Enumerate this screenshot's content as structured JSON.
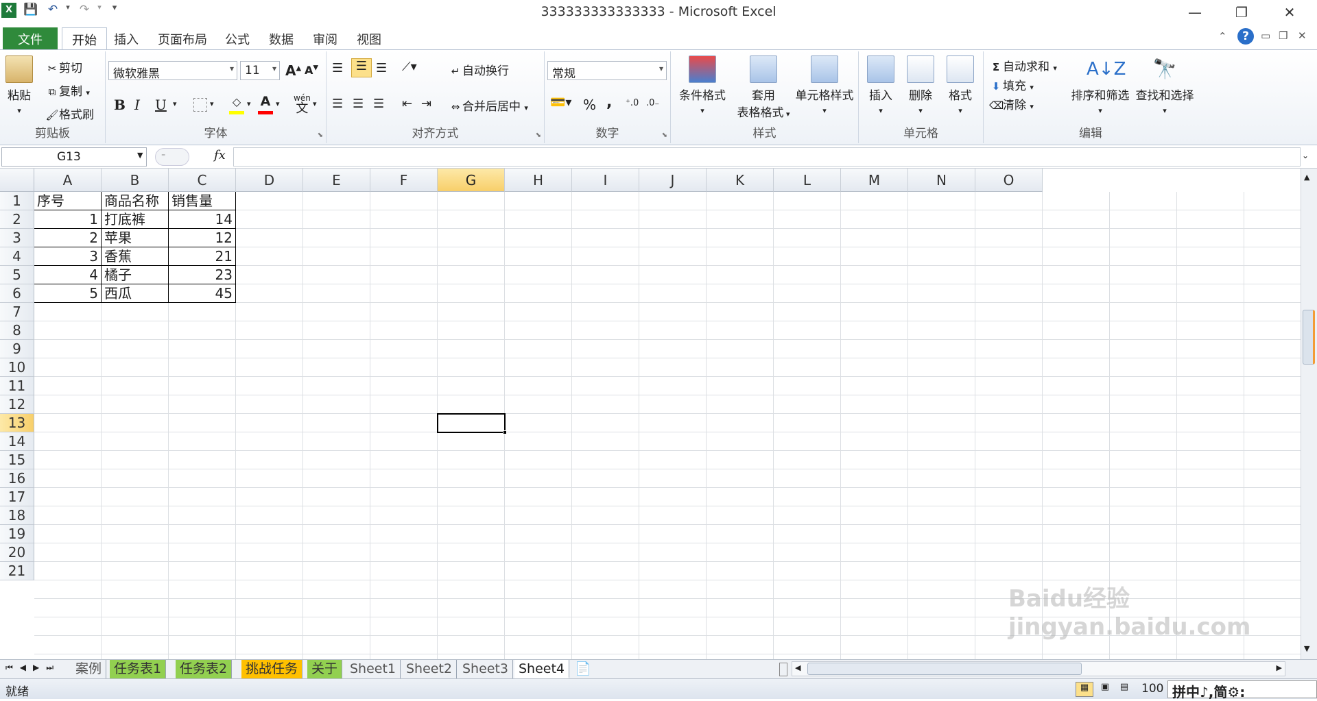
{
  "titlebar": {
    "title": "333333333333333 - Microsoft Excel",
    "qa_icons": [
      "excel-logo-icon",
      "save-icon",
      "undo-icon",
      "redo-icon",
      "customize-icon"
    ]
  },
  "tabs": [
    "文件",
    "开始",
    "插入",
    "页面布局",
    "公式",
    "数据",
    "审阅",
    "视图"
  ],
  "ribbon": {
    "clipboard": {
      "label": "剪贴板",
      "paste": "粘贴",
      "cut": "剪切",
      "copy": "复制",
      "format_painter": "格式刷"
    },
    "font": {
      "label": "字体",
      "name": "微软雅黑",
      "size": "11",
      "bold": "B",
      "italic": "I",
      "underline": "U",
      "grow": "A",
      "shrink": "A",
      "color_letter": "A",
      "phonetic": "wén"
    },
    "alignment": {
      "label": "对齐方式",
      "wrap": "自动换行",
      "merge": "合并后居中"
    },
    "number": {
      "label": "数字",
      "format": "常规",
      "percent": "%",
      "comma": ","
    },
    "styles": {
      "label": "样式",
      "conditional": "条件格式",
      "table_line1": "套用",
      "table_line2": "表格格式",
      "cell_styles": "单元格样式"
    },
    "cells": {
      "label": "单元格",
      "insert": "插入",
      "delete": "删除",
      "format": "格式"
    },
    "editing": {
      "label": "编辑",
      "autosum": "自动求和",
      "fill": "填充",
      "clear": "清除",
      "sort": "排序和筛选",
      "find": "查找和选择"
    }
  },
  "formula": {
    "namebox": "G13",
    "fx": "fx",
    "value": ""
  },
  "columns": [
    "A",
    "B",
    "C",
    "D",
    "E",
    "F",
    "G",
    "H",
    "I",
    "J",
    "K",
    "L",
    "M",
    "N",
    "O"
  ],
  "rows": [
    "1",
    "2",
    "3",
    "4",
    "5",
    "6",
    "7",
    "8",
    "9",
    "10",
    "11",
    "12",
    "13",
    "14",
    "15",
    "16",
    "17",
    "18",
    "19",
    "20",
    "21"
  ],
  "selected": {
    "col": "G",
    "row": "13"
  },
  "table": {
    "headers": [
      "序号",
      "商品名称",
      "销售量"
    ],
    "rows": [
      {
        "no": "1",
        "name": "打底裤",
        "qty": "14"
      },
      {
        "no": "2",
        "name": "苹果",
        "qty": "12"
      },
      {
        "no": "3",
        "name": "香蕉",
        "qty": "21"
      },
      {
        "no": "4",
        "name": "橘子",
        "qty": "23"
      },
      {
        "no": "5",
        "name": "西瓜",
        "qty": "45"
      }
    ]
  },
  "sheets": [
    {
      "name": "案例",
      "color": ""
    },
    {
      "name": "任务表1",
      "color": "#92d050"
    },
    {
      "name": "任务表2",
      "color": "#92d050"
    },
    {
      "name": "挑战任务",
      "color": "#ffc000"
    },
    {
      "name": "关于",
      "color": "#92d050"
    },
    {
      "name": "Sheet1",
      "color": ""
    },
    {
      "name": "Sheet2",
      "color": ""
    },
    {
      "name": "Sheet3",
      "color": ""
    },
    {
      "name": "Sheet4",
      "color": "",
      "active": true
    }
  ],
  "status": {
    "ready": "就绪",
    "zoom": "100",
    "ime": "拼中♪,简⚙:"
  },
  "watermark": "Baidu经验 jingyan.baidu.com"
}
